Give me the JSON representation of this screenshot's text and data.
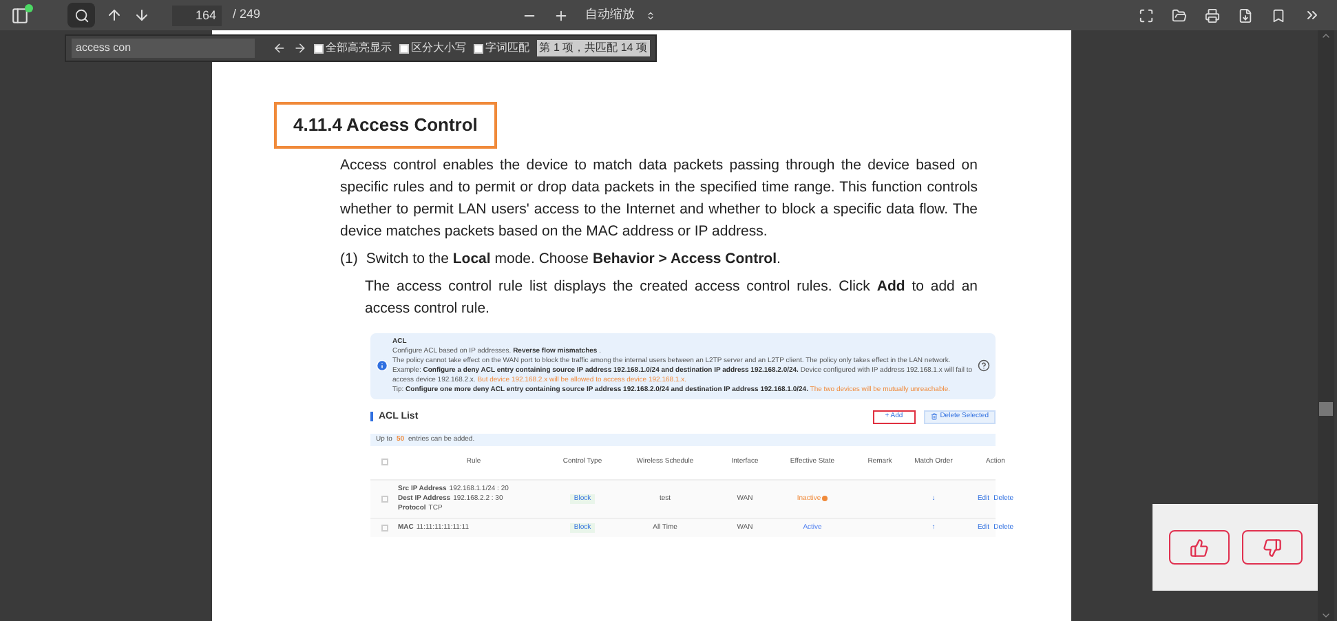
{
  "toolbar": {
    "page_number": "164",
    "page_total": "/ 249",
    "zoom": "自动缩放"
  },
  "find_bar": {
    "query": "access con",
    "options": [
      {
        "label": "全部高亮显示",
        "checked": false
      },
      {
        "label": "区分大小写",
        "checked": false
      },
      {
        "label": "字词匹配",
        "checked": false
      }
    ],
    "result": "第 1 项，共匹配 14 项"
  },
  "document": {
    "heading": "4.11.4  Access Control",
    "paragraph": "Access control enables the device to match data packets passing through the device based on specific rules and to permit or drop data packets in the specified time range. This function controls whether to permit LAN users' access to the Internet and whether to block a specific data flow. The device matches packets based on the MAC address or IP address.",
    "step": {
      "number": "(1)",
      "text": "Switch to the **Local** mode. Choose **Behavior > Access Control**."
    },
    "step_note": "The access control rule list displays the created access control rules. Click **Add** to add an access control rule.",
    "figure": {
      "info": {
        "title": "ACL",
        "lines": [
          [
            {
              "kind": "plain",
              "text": "Configure ACL based on IP addresses. "
            },
            {
              "kind": "bold",
              "text": "Reverse flow mismatches"
            },
            {
              "kind": "plain",
              "text": " ."
            }
          ],
          [
            {
              "kind": "plain",
              "text": "The policy cannot take effect on the WAN port to block the traffic among the internal users between an L2TP server and an L2TP client. The policy only takes effect in the LAN network."
            }
          ],
          [
            {
              "kind": "plain",
              "text": "Example: "
            },
            {
              "kind": "bold",
              "text": "Configure a deny ACL entry containing source IP address 192.168.1.0/24 and destination IP address 192.168.2.0/24."
            },
            {
              "kind": "plain",
              "text": " Device configured with IP address 192.168.1.x will fail to access device 192.168.2.x. "
            },
            {
              "kind": "warning",
              "text": "But device 192.168.2.x will be allowed to access device 192.168.1.x."
            }
          ],
          [
            {
              "kind": "plain",
              "text": "Tip: "
            },
            {
              "kind": "bold",
              "text": "Configure one more deny ACL entry containing source IP address 192.168.2.0/24 and destination IP address 192.168.1.0/24."
            },
            {
              "kind": "warning",
              "text": " The two devices will be mutually unreachable."
            }
          ]
        ]
      },
      "list_title": "ACL List",
      "add_button": "+ Add",
      "delete_button": "Delete Selected",
      "limit_note": {
        "before": "Up to",
        "count": "50",
        "after": "entries can be added."
      },
      "select_all_checked": false,
      "columns": [
        "Rule",
        "Control Type",
        "Wireless Schedule",
        "Interface",
        "Effective State",
        "Remark",
        "Match Order",
        "Action"
      ],
      "rows": [
        {
          "checked": false,
          "rule": [
            {
              "label": "Src IP Address",
              "value": "192.168.1.1/24 : 20"
            },
            {
              "label": "Dest IP Address",
              "value": "192.168.2.2 : 30"
            },
            {
              "label": "Protocol",
              "value": "TCP"
            }
          ],
          "control_type": "Block",
          "schedule": "test",
          "interface": "WAN",
          "state": {
            "kind": "inactive",
            "text": "Inactive"
          },
          "order": "↓",
          "actions": [
            "Edit",
            "Delete"
          ]
        },
        {
          "checked": false,
          "rule": [
            {
              "label": "MAC",
              "value": "11:11:11:11:11:11"
            }
          ],
          "control_type": "Block",
          "schedule": "All Time",
          "interface": "WAN",
          "state": {
            "kind": "active",
            "text": "Active"
          },
          "order": "↑",
          "actions": [
            "Edit",
            "Delete"
          ]
        }
      ]
    }
  }
}
